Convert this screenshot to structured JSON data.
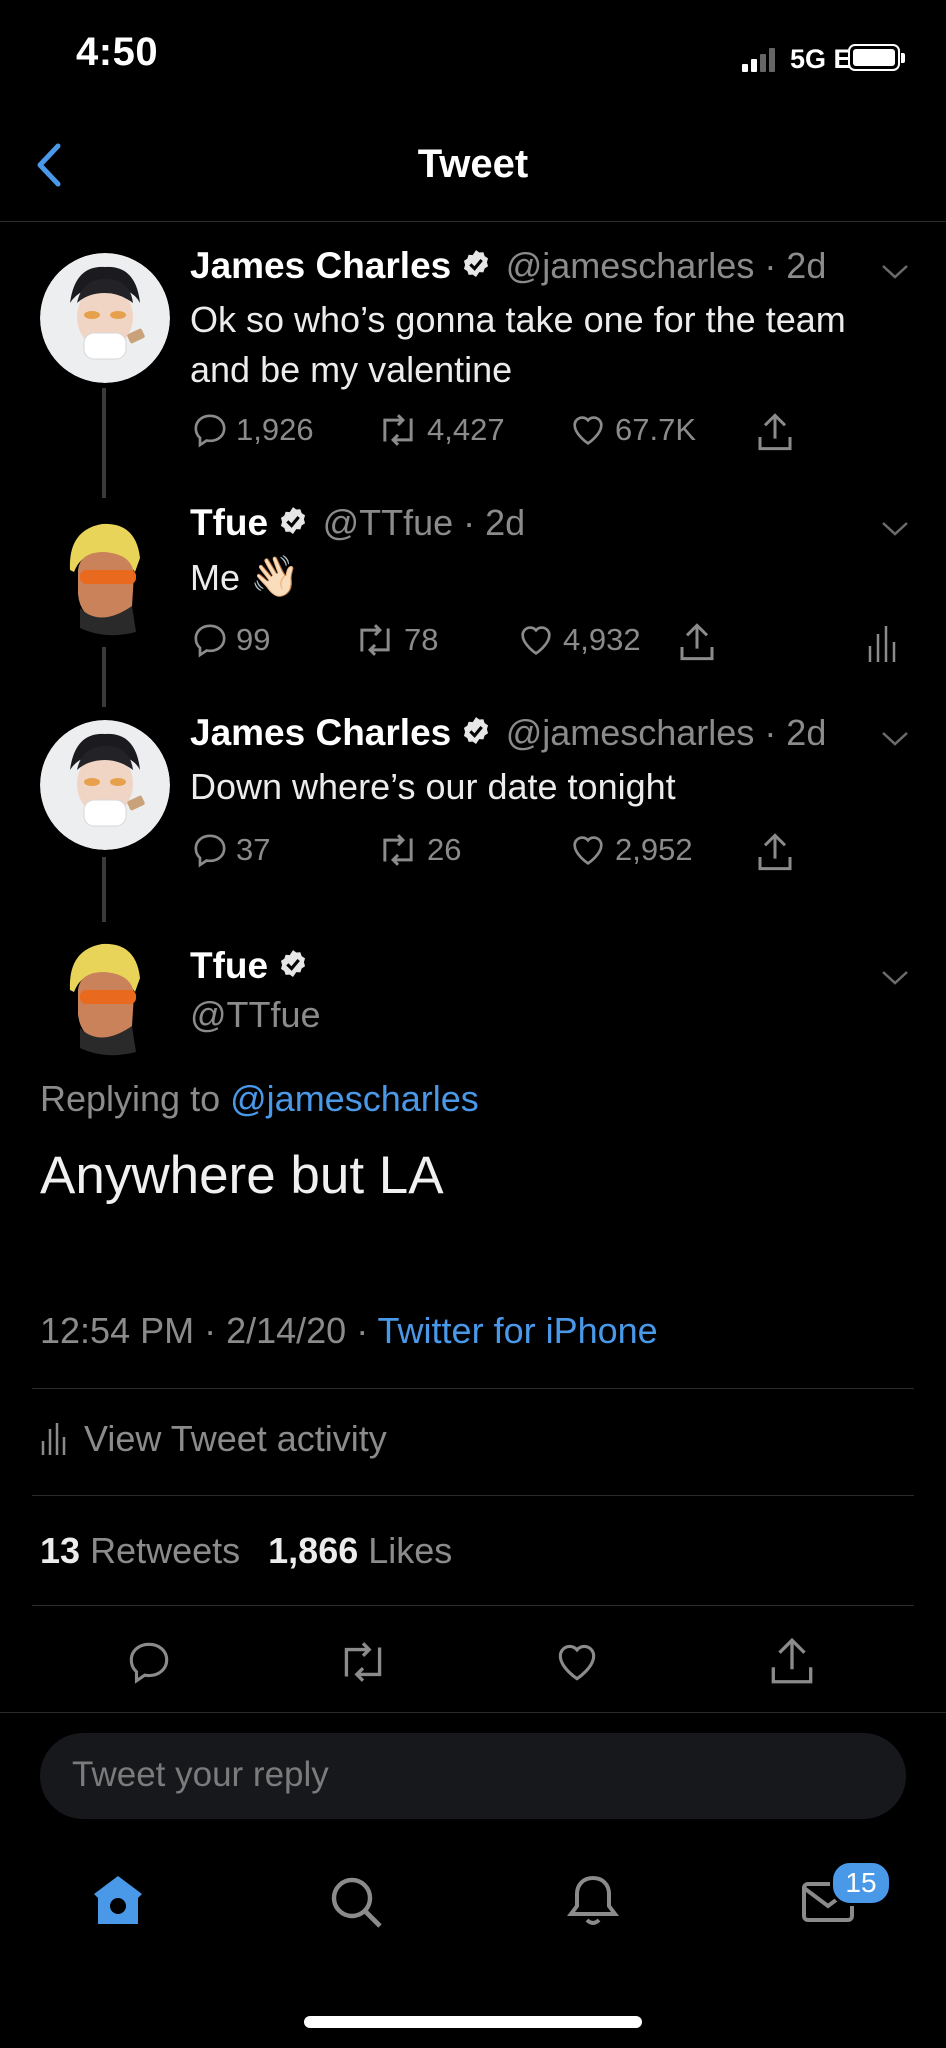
{
  "status_bar": {
    "time": "4:50",
    "network": "5G E"
  },
  "nav": {
    "title": "Tweet"
  },
  "thread": [
    {
      "name": "James Charles",
      "handle": "@jamescharles · 2d",
      "text_lines": [
        "Ok so who’s gonna take one for the team",
        "and be my valentine"
      ],
      "replies": "1,926",
      "retweets": "4,427",
      "likes": "67.7K"
    },
    {
      "name": "Tfue",
      "handle": "@TTfue · 2d",
      "text": "Me",
      "emoji": "👋🏻",
      "replies": "99",
      "retweets": "78",
      "likes": "4,932"
    },
    {
      "name": "James Charles",
      "handle": "@jamescharles · 2d",
      "text": "Down where’s our date tonight",
      "replies": "37",
      "retweets": "26",
      "likes": "2,952"
    }
  ],
  "main_tweet": {
    "name": "Tfue",
    "handle": "@TTfue",
    "replying_prefix": "Replying to",
    "replying_to": "@jamescharles",
    "text": "Anywhere but LA",
    "timestamp": "12:54 PM · 2/14/20 ·",
    "source": "Twitter for iPhone",
    "activity_label": "View Tweet activity",
    "retweets_count": "13",
    "retweets_label": "Retweets",
    "likes_count": "1,866",
    "likes_label": "Likes"
  },
  "reply": {
    "placeholder": "Tweet your reply"
  },
  "tab_bar": {
    "messages_badge": "15"
  },
  "colors": {
    "accent": "#4a99e9",
    "background": "#000000"
  }
}
